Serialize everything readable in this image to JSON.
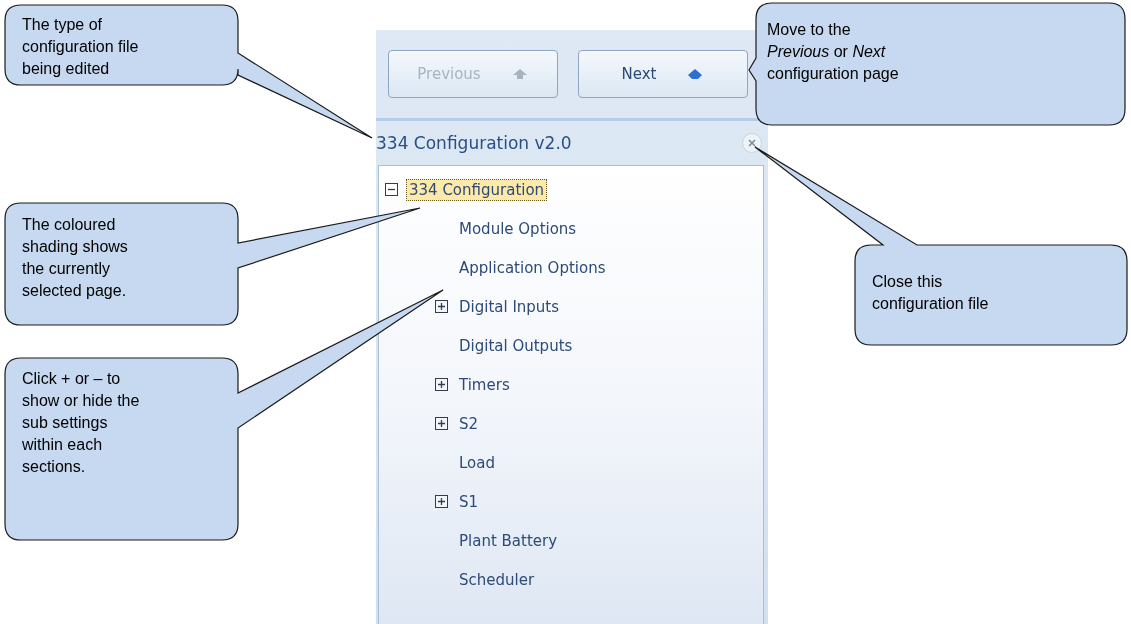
{
  "panel": {
    "buttons": [
      {
        "kind": "previous",
        "label": "Previous",
        "disabled": true
      },
      {
        "kind": "next",
        "label": "Next",
        "disabled": false
      }
    ],
    "title": "334 Configuration v2.0",
    "tree": [
      {
        "kind": "node",
        "label": "334 Configuration",
        "expanded": true,
        "selected": true,
        "children": [
          {
            "kind": "leaf",
            "label": "Module Options",
            "selected": false
          },
          {
            "kind": "leaf",
            "label": "Application Options",
            "selected": false
          },
          {
            "kind": "node",
            "label": "Digital Inputs",
            "expanded": false,
            "selected": false
          },
          {
            "kind": "leaf",
            "label": "Digital Outputs",
            "selected": false
          },
          {
            "kind": "node",
            "label": "Timers",
            "expanded": false,
            "selected": false
          },
          {
            "kind": "node",
            "label": "S2",
            "expanded": false,
            "selected": false
          },
          {
            "kind": "leaf",
            "label": "Load",
            "selected": false
          },
          {
            "kind": "node",
            "label": "S1",
            "expanded": false,
            "selected": false
          },
          {
            "kind": "leaf",
            "label": "Plant Battery",
            "selected": false
          },
          {
            "kind": "leaf",
            "label": "Scheduler",
            "selected": false
          }
        ]
      }
    ]
  },
  "callouts": [
    {
      "text": "The type of configuration file being edited"
    },
    {
      "text": "The coloured shading shows the currently selected page."
    },
    {
      "text": "Click + or – to show or hide the sub settings within each sections."
    },
    {
      "text": "Move to the *Previous* or *Next* configuration page"
    },
    {
      "text": "Close this configuration file"
    }
  ]
}
